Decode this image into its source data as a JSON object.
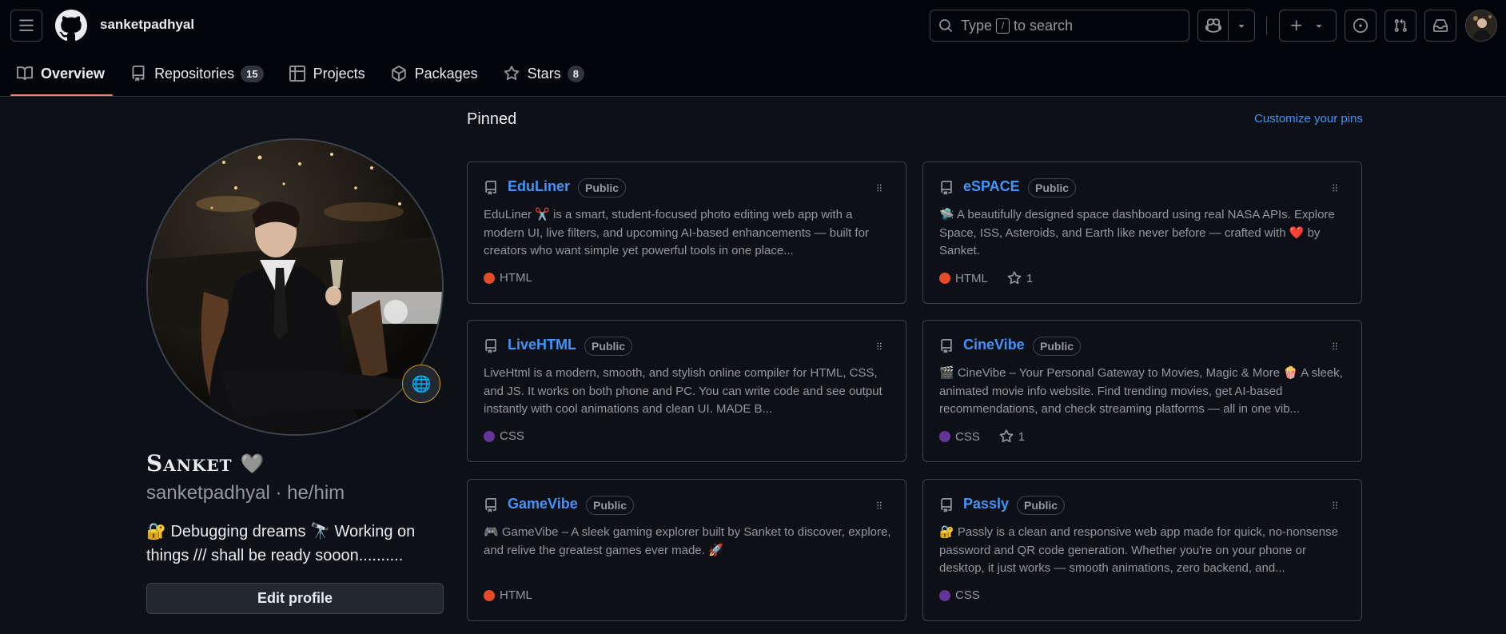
{
  "header": {
    "username": "sanketpadhyal",
    "search_placeholder_prefix": "Type",
    "search_slash": "/",
    "search_placeholder_suffix": "to search"
  },
  "tabs": [
    {
      "label": "Overview",
      "icon": "book-icon",
      "active": true
    },
    {
      "label": "Repositories",
      "icon": "repo-icon",
      "count": "15"
    },
    {
      "label": "Projects",
      "icon": "table-icon"
    },
    {
      "label": "Packages",
      "icon": "package-icon"
    },
    {
      "label": "Stars",
      "icon": "star-icon",
      "count": "8"
    }
  ],
  "profile": {
    "display_name": "Sanket",
    "name_emoji": "🩶",
    "handle": "sanketpadhyal · he/him",
    "bio": "🔐 Debugging dreams 🔭 Working on things /// shall be ready sooon..........",
    "edit_button": "Edit profile",
    "status_emoji": "🌐"
  },
  "pinned": {
    "title": "Pinned",
    "customize": "Customize your pins",
    "repos": [
      {
        "name": "EduLiner",
        "visibility": "Public",
        "description": "EduLiner ✂️ is a smart, student-focused photo editing web app with a modern UI, live filters, and upcoming AI-based enhancements — built for creators who want simple yet powerful tools in one place...",
        "language": "HTML",
        "language_color": "#e34c26",
        "stars": ""
      },
      {
        "name": "eSPACE",
        "visibility": "Public",
        "description": "🛸 A beautifully designed space dashboard using real NASA APIs. Explore Space, ISS, Asteroids, and Earth like never before — crafted with ❤️ by Sanket.",
        "language": "HTML",
        "language_color": "#e34c26",
        "stars": "1"
      },
      {
        "name": "LiveHTML",
        "visibility": "Public",
        "description": "LiveHtml is a modern, smooth, and stylish online compiler for HTML, CSS, and JS. It works on both phone and PC. You can write code and see output instantly with cool animations and clean UI. MADE B...",
        "language": "CSS",
        "language_color": "#663399",
        "stars": ""
      },
      {
        "name": "CineVibe",
        "visibility": "Public",
        "description": "🎬 CineVibe – Your Personal Gateway to Movies, Magic & More 🍿 A sleek, animated movie info website. Find trending movies, get AI-based recommendations, and check streaming platforms — all in one vib...",
        "language": "CSS",
        "language_color": "#663399",
        "stars": "1"
      },
      {
        "name": "GameVibe",
        "visibility": "Public",
        "description": "🎮 GameVibe – A sleek gaming explorer built by Sanket to discover, explore, and relive the greatest games ever made. 🚀",
        "language": "HTML",
        "language_color": "#e34c26",
        "stars": ""
      },
      {
        "name": "Passly",
        "visibility": "Public",
        "description": "🔐 Passly is a clean and responsive web app made for quick, no-nonsense password and QR code generation. Whether you're on your phone or desktop, it just works — smooth animations, zero backend, and...",
        "language": "CSS",
        "language_color": "#663399",
        "stars": ""
      }
    ]
  },
  "colors": {
    "accent_link": "#4493f8",
    "tab_underline": "#f78166",
    "html": "#e34c26",
    "css": "#663399"
  }
}
